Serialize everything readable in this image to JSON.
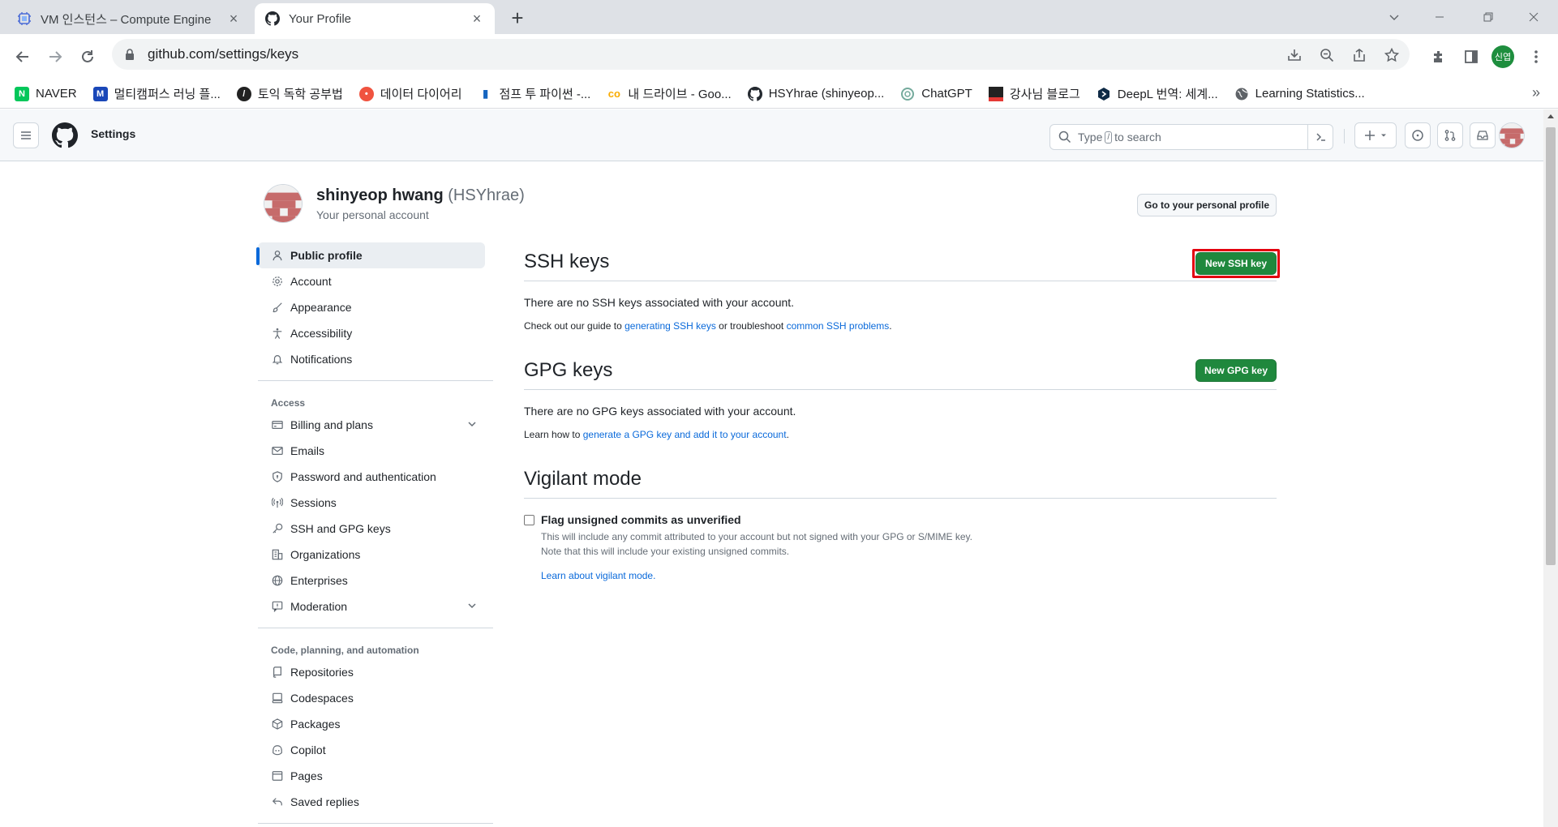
{
  "browser": {
    "tabs": [
      {
        "title": "VM 인스턴스 – Compute Engine",
        "active": false
      },
      {
        "title": "Your Profile",
        "active": true
      }
    ],
    "url": "github.com/settings/keys",
    "profile_initials": "신엽",
    "bookmarks": [
      {
        "label": "NAVER",
        "icon_text": "N",
        "color": "#03c75a"
      },
      {
        "label": "멀티캠퍼스 러닝 플...",
        "icon_text": "M",
        "color": "#1a47b8"
      },
      {
        "label": "토익 독학 공부법",
        "icon_text": "/",
        "color": "#222222"
      },
      {
        "label": "데이터 다이어리",
        "icon_text": "•",
        "color": "#f0533f"
      },
      {
        "label": "점프 투 파이썬 -...",
        "icon_text": "▮",
        "color": "#1565c0"
      },
      {
        "label": "내 드라이브 - Goo...",
        "icon_text": "co",
        "color": "#f9ab00"
      },
      {
        "label": "HSYhrae (shinyeop...",
        "icon_text": "",
        "color": "#24292f"
      },
      {
        "label": "ChatGPT",
        "icon_text": "",
        "color": "#74aa9c"
      },
      {
        "label": "강사님 블로그",
        "icon_text": "",
        "color": "#333333"
      },
      {
        "label": "DeepL 번역: 세계...",
        "icon_text": "",
        "color": "#0f2b46"
      },
      {
        "label": "Learning Statistics...",
        "icon_text": "",
        "color": "#5f6368"
      }
    ]
  },
  "header": {
    "context": "Settings",
    "search_prefix": "Type",
    "search_key": "/",
    "search_suffix": "to search"
  },
  "user": {
    "name": "shinyeop hwang",
    "login": "(HSYhrae)",
    "subtitle": "Your personal account",
    "profile_button": "Go to your personal profile"
  },
  "sidebar": {
    "items": [
      {
        "label": "Public profile",
        "icon": "person-icon",
        "selected": true
      },
      {
        "label": "Account",
        "icon": "gear-icon"
      },
      {
        "label": "Appearance",
        "icon": "paintbrush-icon"
      },
      {
        "label": "Accessibility",
        "icon": "accessibility-icon"
      },
      {
        "label": "Notifications",
        "icon": "bell-icon"
      }
    ],
    "access_heading": "Access",
    "access_items": [
      {
        "label": "Billing and plans",
        "icon": "credit-card-icon",
        "expandable": true
      },
      {
        "label": "Emails",
        "icon": "mail-icon"
      },
      {
        "label": "Password and authentication",
        "icon": "shield-lock-icon"
      },
      {
        "label": "Sessions",
        "icon": "broadcast-icon"
      },
      {
        "label": "SSH and GPG keys",
        "icon": "key-icon"
      },
      {
        "label": "Organizations",
        "icon": "organization-icon"
      },
      {
        "label": "Enterprises",
        "icon": "globe-icon"
      },
      {
        "label": "Moderation",
        "icon": "report-icon",
        "expandable": true
      }
    ],
    "code_heading": "Code, planning, and automation",
    "code_items": [
      {
        "label": "Repositories",
        "icon": "repo-icon"
      },
      {
        "label": "Codespaces",
        "icon": "codespaces-icon"
      },
      {
        "label": "Packages",
        "icon": "package-icon"
      },
      {
        "label": "Copilot",
        "icon": "copilot-icon"
      },
      {
        "label": "Pages",
        "icon": "browser-icon"
      },
      {
        "label": "Saved replies",
        "icon": "reply-icon"
      }
    ]
  },
  "ssh": {
    "title": "SSH keys",
    "button": "New SSH key",
    "empty": "There are no SSH keys associated with your account.",
    "guide_prefix": "Check out our guide to",
    "guide_link1": "generating SSH keys",
    "guide_middle": "or troubleshoot",
    "guide_link2": "common SSH problems",
    "guide_suffix": "."
  },
  "gpg": {
    "title": "GPG keys",
    "button": "New GPG key",
    "empty": "There are no GPG keys associated with your account.",
    "learn_prefix": "Learn how to",
    "learn_link": "generate a GPG key and add it to your account",
    "learn_suffix": "."
  },
  "vigilant": {
    "title": "Vigilant mode",
    "checkbox_label": "Flag unsigned commits as unverified",
    "checked": false,
    "desc1": "This will include any commit attributed to your account but not signed with your GPG or S/MIME key.",
    "desc2": "Note that this will include your existing unsigned commits.",
    "link": "Learn about vigilant mode."
  },
  "colors": {
    "accent_blue": "#0969da",
    "button_green": "#1f883d",
    "highlight_red": "#e3000f"
  }
}
